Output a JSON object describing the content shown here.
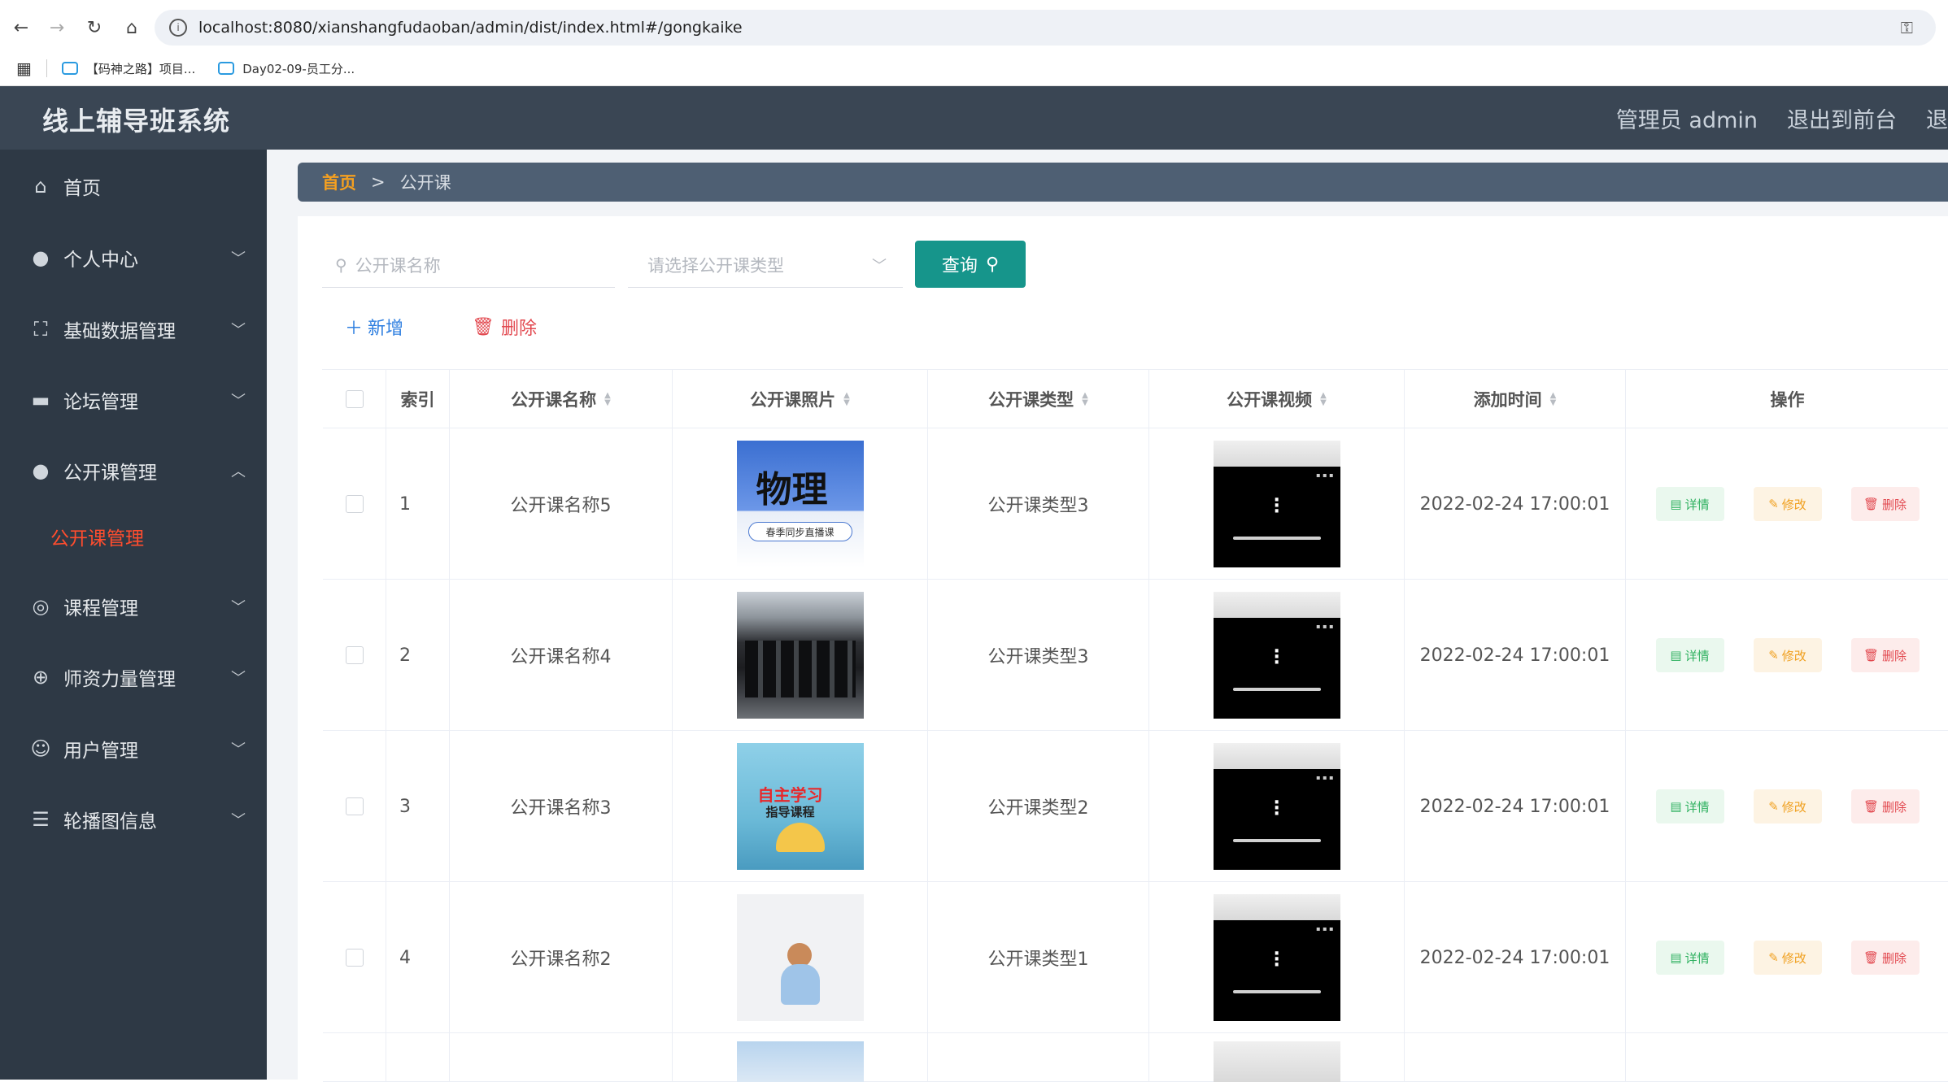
{
  "browser": {
    "url": "localhost:8080/xianshangfudaoban/admin/dist/index.html#/gongkaike",
    "bookmarks": [
      {
        "label": "【码神之路】项目..."
      },
      {
        "label": "Day02-09-员工分..."
      }
    ]
  },
  "header": {
    "title": "线上辅导班系统",
    "admin_label": "管理员 admin",
    "back_label": "退出到前台",
    "trailing": "退"
  },
  "sidebar": {
    "items": [
      {
        "label": "首页",
        "icon": "home-icon"
      },
      {
        "label": "个人中心",
        "icon": "user-icon"
      },
      {
        "label": "基础数据管理",
        "icon": "frame-icon"
      },
      {
        "label": "论坛管理",
        "icon": "chat-icon"
      },
      {
        "label": "公开课管理",
        "icon": "user-icon"
      },
      {
        "label": "课程管理",
        "icon": "compass-icon"
      },
      {
        "label": "师资力量管理",
        "icon": "globe-icon"
      },
      {
        "label": "用户管理",
        "icon": "face-icon"
      },
      {
        "label": "轮播图信息",
        "icon": "list-icon"
      }
    ],
    "submenu_active": "公开课管理"
  },
  "breadcrumb": {
    "home": "首页",
    "separator": ">",
    "current": "公开课"
  },
  "search": {
    "name_placeholder": "公开课名称",
    "type_placeholder": "请选择公开课类型",
    "query_label": "查询"
  },
  "actions": {
    "add_label": "新增",
    "delete_label": "删除"
  },
  "table": {
    "columns": [
      "索引",
      "公开课名称",
      "公开课照片",
      "公开课类型",
      "公开课视频",
      "添加时间",
      "操作"
    ],
    "rows": [
      {
        "index": "1",
        "name": "公开课名称5",
        "type": "公开课类型3",
        "time": "2022-02-24 17:00:01",
        "photo_title": "物理",
        "photo_subtitle": "春季同步直播课"
      },
      {
        "index": "2",
        "name": "公开课名称4",
        "type": "公开课类型3",
        "time": "2022-02-24 17:00:01",
        "photo_title": "",
        "photo_subtitle": ""
      },
      {
        "index": "3",
        "name": "公开课名称3",
        "type": "公开课类型2",
        "time": "2022-02-24 17:00:01",
        "photo_title": "自主学习",
        "photo_subtitle": "指导课程"
      },
      {
        "index": "4",
        "name": "公开课名称2",
        "type": "公开课类型1",
        "time": "2022-02-24 17:00:01",
        "photo_title": "",
        "photo_subtitle": ""
      }
    ],
    "op_detail": "详情",
    "op_edit": "修改",
    "op_delete": "删除"
  },
  "colors": {
    "header_bg": "#3a4654",
    "sidebar_bg": "#2e3945",
    "active_menu": "#ff4d2e",
    "query_button": "#16958b",
    "breadcrumb_home": "#f5a020"
  }
}
